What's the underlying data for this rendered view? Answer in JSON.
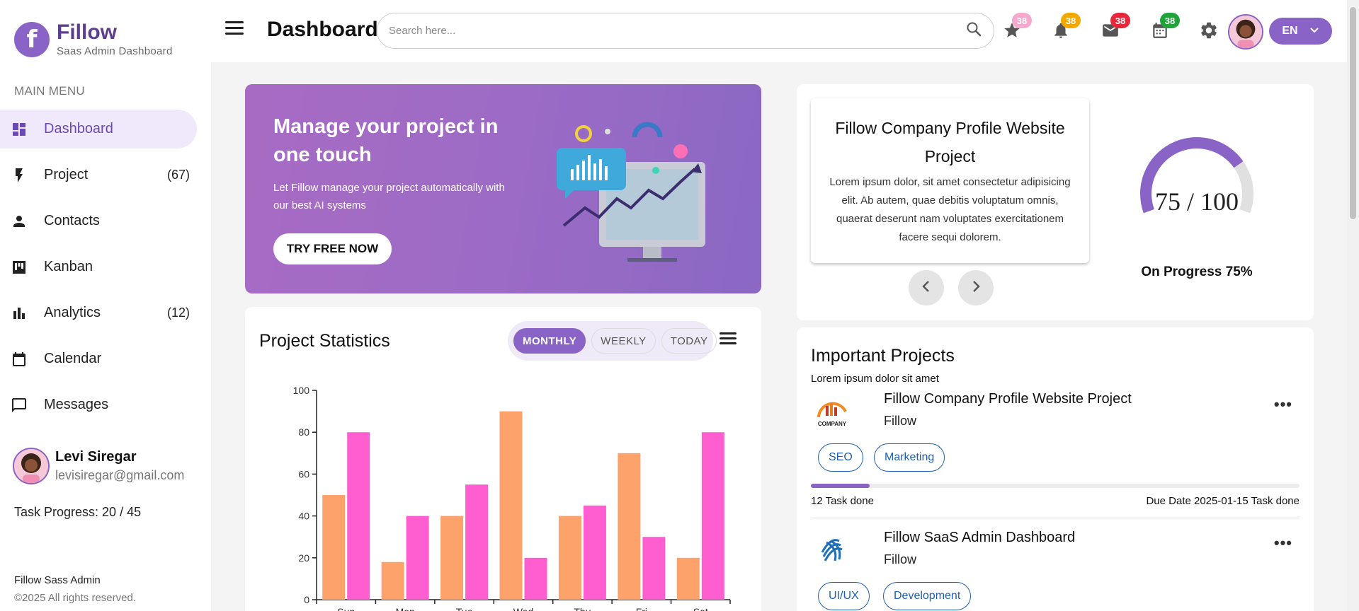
{
  "brand": {
    "name": "Fillow",
    "subtitle": "Saas Admin Dashboard",
    "logo_letter": "f"
  },
  "sidebar": {
    "menu_title": "MAIN MENU",
    "items": [
      {
        "label": "Dashboard",
        "count": "",
        "icon": "dashboard-icon",
        "active": true
      },
      {
        "label": "Project",
        "count": "(67)",
        "icon": "bolt-icon"
      },
      {
        "label": "Contacts",
        "count": "",
        "icon": "person-icon"
      },
      {
        "label": "Kanban",
        "count": "",
        "icon": "kanban-icon"
      },
      {
        "label": "Analytics",
        "count": "(12)",
        "icon": "bar-chart-icon"
      },
      {
        "label": "Calendar",
        "count": "",
        "icon": "calendar-icon"
      },
      {
        "label": "Messages",
        "count": "",
        "icon": "chat-icon"
      }
    ],
    "user": {
      "name": "Levi Siregar",
      "email": "levisiregar@gmail.com"
    },
    "task_progress": "Task Progress: 20 / 45",
    "footer": {
      "line1": "Fillow Sass Admin",
      "line2": "©2025 All rights reserved."
    }
  },
  "header": {
    "title": "Dashboard",
    "search_placeholder": "Search here...",
    "badges": [
      {
        "icon": "star-icon",
        "count": "38",
        "color": "#f7a8cf"
      },
      {
        "icon": "bell-icon",
        "count": "38",
        "color": "#f5a800"
      },
      {
        "icon": "mail-icon",
        "count": "38",
        "color": "#e8273b"
      },
      {
        "icon": "calendar-icon",
        "count": "38",
        "color": "#1fa33a"
      }
    ],
    "language": "EN"
  },
  "banner": {
    "title": "Manage your project in one touch",
    "description": "Let Fillow manage your project automatically with our best AI systems",
    "button": "TRY FREE NOW"
  },
  "stats": {
    "title": "Project Statistics",
    "tabs": [
      "MONTHLY",
      "WEEKLY",
      "TODAY"
    ],
    "active_tab": "MONTHLY"
  },
  "chart_data": {
    "type": "bar",
    "categories": [
      "Sun",
      "Mon",
      "Tue",
      "Wed",
      "Thu",
      "Fri",
      "Sat"
    ],
    "series": [
      {
        "values": [
          50,
          18,
          40,
          90,
          40,
          70,
          20
        ],
        "color": "#fda26b"
      },
      {
        "values": [
          80,
          40,
          55,
          20,
          45,
          30,
          80
        ],
        "color": "#ff5ed1"
      }
    ],
    "ylim": [
      0,
      100
    ],
    "yticks": [
      0,
      20,
      40,
      60,
      80,
      100
    ],
    "grid": false
  },
  "profile": {
    "slide_title": "Fillow Company Profile Website Project",
    "slide_desc": "Lorem ipsum dolor, sit amet consectetur adipisicing elit. Ab autem, quae debitis voluptatum omnis, quaerat deserunt nam voluptates exercitationem facere sequi dolorem.",
    "gauge_text": "75 / 100",
    "gauge_value": 0.75,
    "gauge_label": "On Progress 75%"
  },
  "important": {
    "title": "Important Projects",
    "subtitle": "Lorem ipsum dolor sit amet",
    "projects": [
      {
        "name": "Fillow Company Profile Website Project",
        "company": "Fillow",
        "tags": [
          "SEO",
          "Marketing"
        ],
        "done": "12 Task done",
        "due": "Due Date 2025-01-15 Task done",
        "progress": 0.12,
        "more": "•••"
      },
      {
        "name": "Fillow SaaS Admin Dashboard",
        "company": "Fillow",
        "tags": [
          "UI/UX",
          "Development"
        ],
        "more": "•••"
      }
    ],
    "logo_text": "COMPANY"
  }
}
